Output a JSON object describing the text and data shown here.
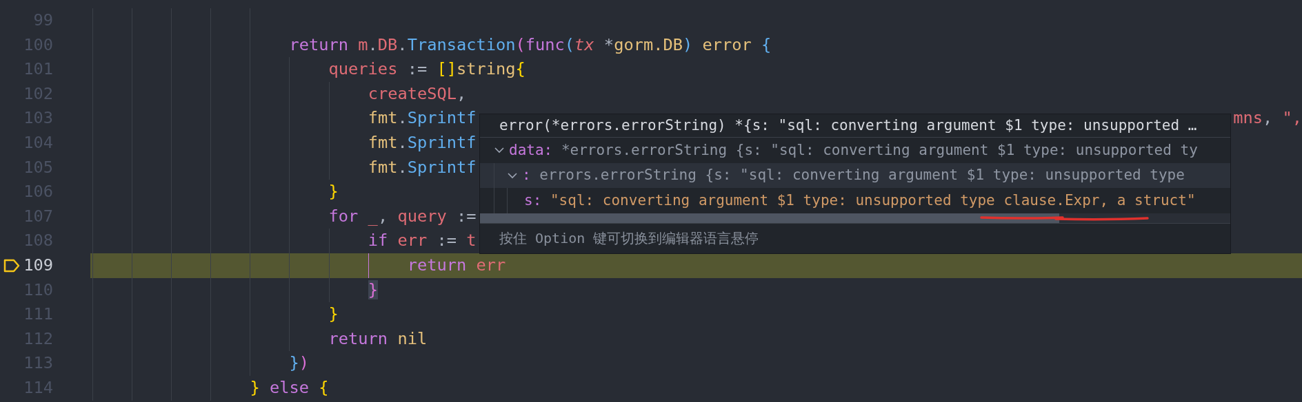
{
  "editor": {
    "lines": [
      {
        "children": [
          {
            "number": "99",
            "current": false
          },
          {
            "number": "100",
            "current": false,
            "tokens": [
              {
                "text": "return ",
                "kind": "keyword"
              },
              {
                "text": "m",
                "kind": "variable"
              },
              {
                "text": ".",
                "kind": "punct"
              },
              {
                "text": "DB",
                "kind": "variable"
              },
              {
                "text": ".",
                "kind": "punct"
              },
              {
                "text": "Transaction",
                "kind": "function"
              },
              {
                "text": "(",
                "kind": "bracket2"
              },
              {
                "text": "func",
                "kind": "keyword"
              },
              {
                "text": "(",
                "kind": "bracket3"
              },
              {
                "text": "tx",
                "kind": "param"
              },
              {
                "text": " *",
                "kind": "punct"
              },
              {
                "text": "gorm.DB",
                "kind": "type"
              },
              {
                "text": ")",
                "kind": "bracket3"
              },
              {
                "text": " error ",
                "kind": "type"
              },
              {
                "text": "{",
                "kind": "bracket3"
              }
            ],
            "children": [
              {
                "number": "101",
                "current": false,
                "tokens": [
                  {
                    "text": "queries",
                    "kind": "variable"
                  },
                  {
                    "text": " := ",
                    "kind": "punct"
                  },
                  {
                    "text": "[]",
                    "kind": "bracket1"
                  },
                  {
                    "text": "string",
                    "kind": "type"
                  },
                  {
                    "text": "{",
                    "kind": "bracket1"
                  }
                ],
                "children": [
                  {
                    "number": "102",
                    "current": false,
                    "tokens": [
                      {
                        "text": "createSQL",
                        "kind": "variable"
                      },
                      {
                        "text": ",",
                        "kind": "punct"
                      }
                    ]
                  },
                  {
                    "number": "103",
                    "current": false,
                    "tokens": [
                      {
                        "text": "fmt",
                        "kind": "type"
                      },
                      {
                        "text": ".",
                        "kind": "punct"
                      },
                      {
                        "text": "Sprintf",
                        "kind": "function"
                      }
                    ],
                    "tail": [
                      {
                        "text": "mns",
                        "kind": "variable"
                      },
                      {
                        "text": ", ",
                        "kind": "punct"
                      },
                      {
                        "text": "\",",
                        "kind": "string"
                      }
                    ]
                  },
                  {
                    "number": "104",
                    "current": false,
                    "tokens": [
                      {
                        "text": "fmt",
                        "kind": "type"
                      },
                      {
                        "text": ".",
                        "kind": "punct"
                      },
                      {
                        "text": "Sprintf",
                        "kind": "function"
                      }
                    ]
                  },
                  {
                    "number": "105",
                    "current": false,
                    "tokens": [
                      {
                        "text": "fmt",
                        "kind": "type"
                      },
                      {
                        "text": ".",
                        "kind": "punct"
                      },
                      {
                        "text": "Sprintf",
                        "kind": "function"
                      }
                    ]
                  }
                ]
              },
              {
                "number": "106",
                "current": false,
                "tokens": [
                  {
                    "text": "}",
                    "kind": "bracket1"
                  }
                ]
              },
              {
                "number": "107",
                "current": false,
                "tokens": [
                  {
                    "text": "for ",
                    "kind": "keyword"
                  },
                  {
                    "text": "_",
                    "kind": "variable"
                  },
                  {
                    "text": ", ",
                    "kind": "punct"
                  },
                  {
                    "text": "query",
                    "kind": "variable"
                  },
                  {
                    "text": " :=",
                    "kind": "punct"
                  }
                ],
                "children": [
                  {
                    "number": "108",
                    "current": false,
                    "tokens": [
                      {
                        "text": "if ",
                        "kind": "keyword"
                      },
                      {
                        "text": "err",
                        "kind": "variable"
                      },
                      {
                        "text": " := ",
                        "kind": "punct"
                      },
                      {
                        "text": "t",
                        "kind": "variable"
                      }
                    ],
                    "children": [
                      {
                        "number": "109",
                        "current": true,
                        "tokens": [
                          {
                            "text": "return ",
                            "kind": "keyword"
                          },
                          {
                            "text": "err",
                            "kind": "variable"
                          }
                        ]
                      }
                    ]
                  },
                  {
                    "number": "110",
                    "current": false,
                    "tokens": [
                      {
                        "text": "}",
                        "kind": "bracket2",
                        "matched": true
                      }
                    ]
                  }
                ]
              },
              {
                "number": "111",
                "current": false,
                "tokens": [
                  {
                    "text": "}",
                    "kind": "bracket1"
                  }
                ]
              },
              {
                "number": "112",
                "current": false,
                "tokens": [
                  {
                    "text": "return ",
                    "kind": "keyword"
                  },
                  {
                    "text": "nil",
                    "kind": "type"
                  }
                ]
              }
            ]
          },
          {
            "number": "113",
            "current": false,
            "tokens": [
              {
                "text": "}",
                "kind": "bracket3"
              },
              {
                "text": ")",
                "kind": "bracket2"
              }
            ]
          }
        ]
      },
      {
        "number": "114",
        "current": false,
        "tokens": [
          {
            "text": "} ",
            "kind": "bracket1"
          },
          {
            "text": "else ",
            "kind": "keyword"
          },
          {
            "text": "{",
            "kind": "bracket1"
          }
        ]
      }
    ]
  },
  "hover": {
    "header": "error(*errors.errorString) *{s: \"sql: converting argument $1 type: unsupported …",
    "tree": [
      {
        "key": "data:",
        "value": "*errors.errorString {s: \"sql: converting argument $1 type: unsupported ty",
        "color": "#8f96a3",
        "expanded": true,
        "selected": false,
        "children": [
          {
            "key": ":",
            "value": "errors.errorString {s: \"sql: converting argument $1 type: unsupported type",
            "color": "#8f96a3",
            "expanded": true,
            "selected": true,
            "children": [
              {
                "key": "s:",
                "value": "\"sql: converting argument $1 type: unsupported type clause.Expr, a struct\"",
                "color": "#d19a66",
                "selected": false
              }
            ]
          }
        ]
      }
    ],
    "footer": "按住 Option 键可切换到编辑器语言悬停"
  }
}
